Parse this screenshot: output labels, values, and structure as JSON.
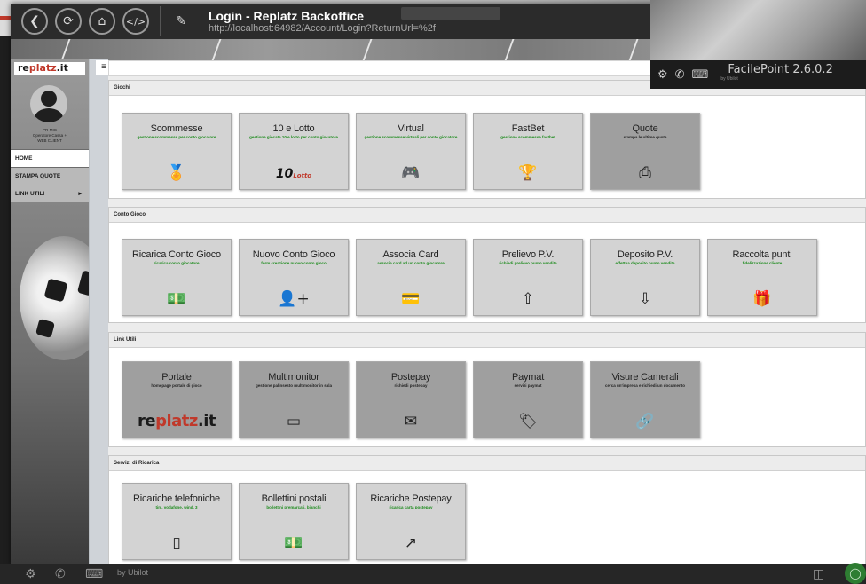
{
  "window": {
    "title": "Login - Replatz Backoffice",
    "url": "http://localhost:64982/Account/Login?ReturnUrl=%2f"
  },
  "sidebar": {
    "logo": {
      "pre": "re",
      "mid": "platz",
      "suf": ".it"
    },
    "user": {
      "line1": "PR-MIC",
      "line2": "Operatore Cassa +",
      "line3": "WEB CLIENT"
    },
    "menu": [
      {
        "label": "HOME"
      },
      {
        "label": "STAMPA QUOTE"
      },
      {
        "label": "LINK UTILI",
        "caret": "▸"
      }
    ]
  },
  "sections": [
    {
      "title": "Giochi",
      "tiles": [
        {
          "title": "Scommesse",
          "sub": "gestione scommesse per conto giocatore",
          "icon": "medal-icon",
          "glyph": "🏅"
        },
        {
          "title": "10 e Lotto",
          "sub": "gestione giocata 10 e lotto per conto giocatore",
          "icon": "10elotto-logo"
        },
        {
          "title": "Virtual",
          "sub": "gestione scommesse virtuali per conto giocatore",
          "icon": "gamepad-icon",
          "glyph": "🎮"
        },
        {
          "title": "FastBet",
          "sub": "gestione scommesse fastbet",
          "icon": "trophy-icon",
          "glyph": "🏆"
        },
        {
          "title": "Quote",
          "sub": "stampa le ultime quote",
          "icon": "print-icon",
          "glyph": "⎙",
          "dark": true
        }
      ]
    },
    {
      "title": "Conto Gioco",
      "tiles": [
        {
          "title": "Ricarica Conto Gioco",
          "sub": "ricarica conto giocatore",
          "icon": "cash-icon",
          "glyph": "💵"
        },
        {
          "title": "Nuovo Conto Gioco",
          "sub": "form creazione nuovo conto gioco",
          "icon": "add-user-icon",
          "glyph": "👤+"
        },
        {
          "title": "Associa Card",
          "sub": "associa card ad un conto giocatore",
          "icon": "card-icon",
          "glyph": "💳"
        },
        {
          "title": "Prelievo P.V.",
          "sub": "richiedi prelievo punto vendita",
          "icon": "arrow-up-circle-icon",
          "glyph": "⇧"
        },
        {
          "title": "Deposito P.V.",
          "sub": "effettua deposito punto vendita",
          "icon": "arrow-down-circle-icon",
          "glyph": "⇩"
        },
        {
          "title": "Raccolta punti",
          "sub": "fidelizzazione cliente",
          "icon": "gift-icon",
          "glyph": "🎁"
        }
      ]
    },
    {
      "title": "Link Utili",
      "tiles": [
        {
          "title": "Portale",
          "sub": "homepage portale di gioco",
          "icon": "replatz-logo",
          "dark": true
        },
        {
          "title": "Multimonitor",
          "sub": "gestione palinsesto multimonitor in sala",
          "icon": "monitor-icon",
          "glyph": "▭",
          "dark": true
        },
        {
          "title": "Postepay",
          "sub": "richiedi postepay",
          "icon": "envelope-icon",
          "glyph": "✉",
          "dark": true
        },
        {
          "title": "Paymat",
          "sub": "servizi paymat",
          "icon": "tag-icon",
          "glyph": "🏷",
          "dark": true
        },
        {
          "title": "Visure Camerali",
          "sub": "cerca un'impresa e richiedi un documento",
          "icon": "link-icon",
          "glyph": "🔗",
          "dark": true
        }
      ]
    },
    {
      "title": "Servizi di Ricarica",
      "tiles": [
        {
          "title": "Ricariche telefoniche",
          "sub": "tim, vodafone, wind, 3",
          "icon": "phone-icon",
          "glyph": "▯"
        },
        {
          "title": "Bollettini postali",
          "sub": "bollettini premarcati, bianchi",
          "icon": "cash-icon",
          "glyph": "💵"
        },
        {
          "title": "Ricariche Postepay",
          "sub": "ricarica carta postepay",
          "icon": "share-icon",
          "glyph": "↗"
        }
      ]
    }
  ],
  "tile_logos": {
    "ten": "10",
    "lotto": "Lotto",
    "replatz_pre": "re",
    "replatz_mid": "platz",
    "replatz_suf": ".it"
  },
  "facilepoint": {
    "name": "FacilePoint 2.6.0.2",
    "by": "by Ubilot"
  },
  "bottom": {
    "text": "by Ubilot"
  },
  "colors": {
    "accent_red": "#c0392b",
    "green_sub": "#1a8a1a",
    "tile_light": "#d3d3d3",
    "tile_dark": "#9f9f9f"
  }
}
